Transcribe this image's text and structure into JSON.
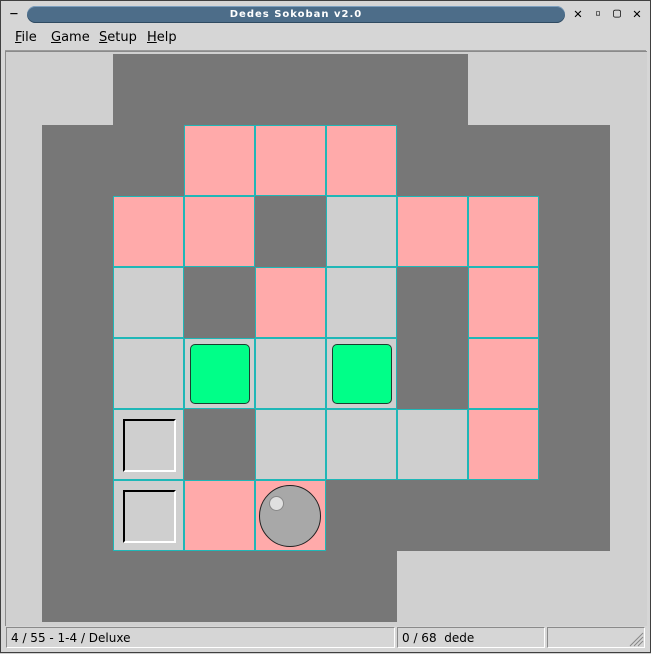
{
  "window": {
    "title": "Dedes Sokoban v2.0",
    "controls": {
      "menu": "−",
      "minimize": "✕",
      "restore": "▫",
      "maximize": "▢",
      "close": "✕"
    }
  },
  "menu": [
    {
      "label": "File",
      "mnemonic": "F",
      "rest": "ile"
    },
    {
      "label": "Game",
      "mnemonic": "G",
      "rest": "ame"
    },
    {
      "label": "Setup",
      "mnemonic": "S",
      "rest": "etup"
    },
    {
      "label": "Help",
      "mnemonic": "H",
      "rest": "elp"
    }
  ],
  "status": {
    "level": "4 / 55 - 1-4 / Deluxe",
    "moves": "0 / 68",
    "player": "dede"
  },
  "colors": {
    "wall": "#777777",
    "floor": "#cfcfcf",
    "goal": "#ffaaaa",
    "crate": "#00ff88",
    "grid_line": "#1fb7b7"
  },
  "board": {
    "legend": {
      " ": "outside",
      "#": "wall",
      ".": "floor",
      "G": "goal",
      "B": "crate-on-floor",
      "S": "socket",
      "P": "player-on-goal"
    },
    "rows": [
      " ##### ",
      "##GGG###",
      "#GG#.GG#",
      "#.#G.#G#",
      "#.B.B#G#",
      "#S#...G#",
      "#SGP####",
      "#####   "
    ]
  }
}
